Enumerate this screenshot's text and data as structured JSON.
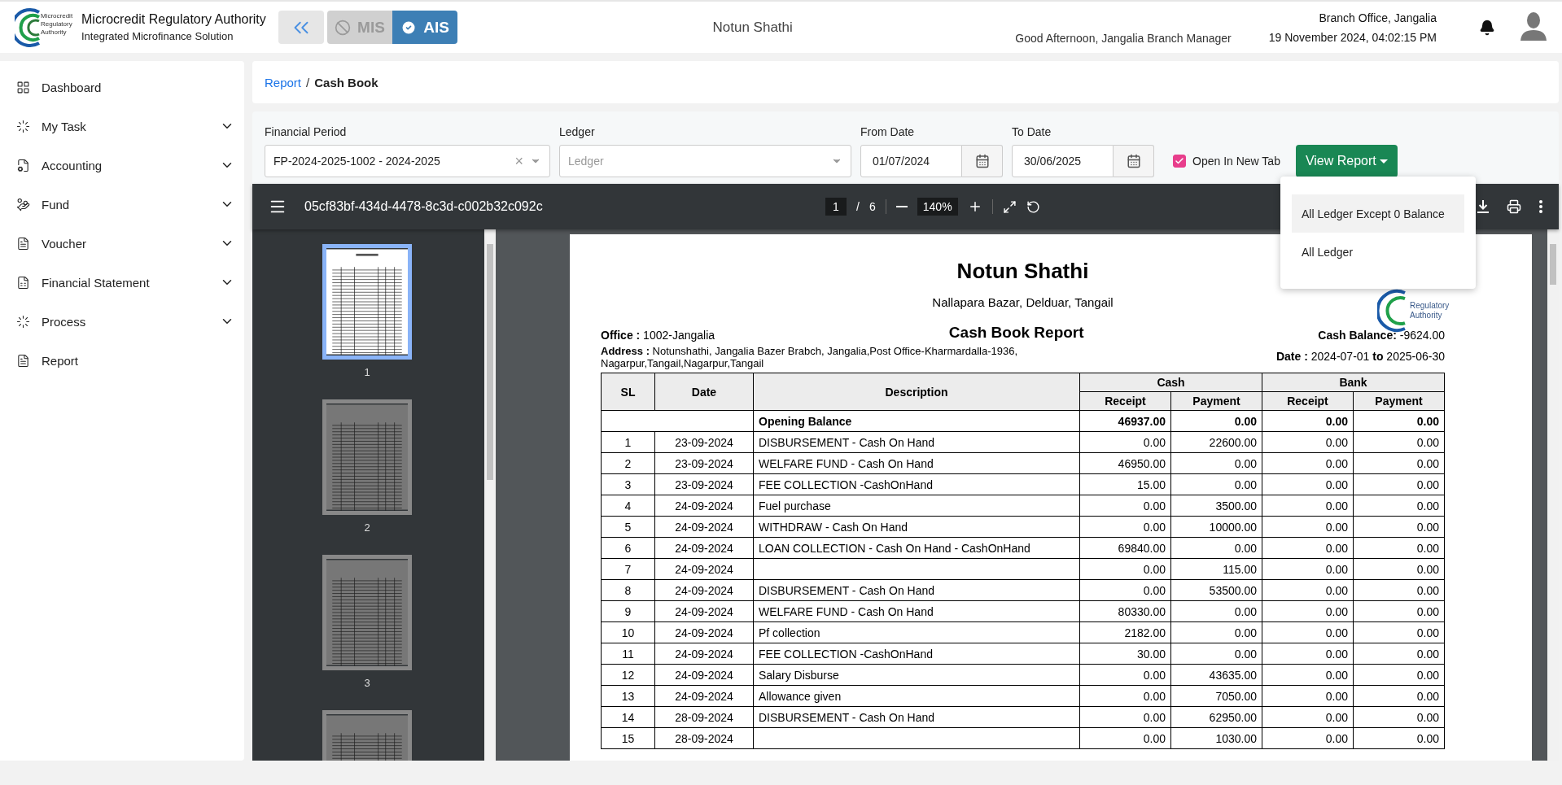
{
  "header": {
    "logo_lines": [
      "Microcredit",
      "Regulatory",
      "Authority"
    ],
    "org_name": "Microcredit Regulatory Authority",
    "org_subtitle": "Integrated Microfinance Solution",
    "modules": [
      {
        "label": "MIS",
        "selected": false
      },
      {
        "label": "AIS",
        "selected": true
      }
    ],
    "center_title": "Notun Shathi",
    "greeting": "Good Afternoon, Jangalia Branch Manager",
    "office": "Branch Office, Jangalia",
    "datetime": "19 November 2024, 04:02:15 PM"
  },
  "sidebar": {
    "items": [
      {
        "label": "Dashboard",
        "expandable": false
      },
      {
        "label": "My Task",
        "expandable": true
      },
      {
        "label": "Accounting",
        "expandable": true
      },
      {
        "label": "Fund",
        "expandable": true
      },
      {
        "label": "Voucher",
        "expandable": true
      },
      {
        "label": "Financial Statement",
        "expandable": true
      },
      {
        "label": "Process",
        "expandable": true
      },
      {
        "label": "Report",
        "expandable": false
      }
    ]
  },
  "breadcrumb": [
    {
      "label": "Report",
      "kind": "link"
    },
    {
      "label": "/",
      "kind": "separator"
    },
    {
      "label": "Cash Book",
      "kind": "current"
    }
  ],
  "filters": {
    "financial_period": {
      "label": "Financial Period",
      "value": "FP-2024-2025-1002 - 2024-2025",
      "clear": "×"
    },
    "ledger": {
      "label": "Ledger",
      "placeholder": "Ledger"
    },
    "from_date": {
      "label": "From Date",
      "value": "01/07/2024"
    },
    "to_date": {
      "label": "To Date",
      "value": "30/06/2025"
    },
    "open_in_new_tab": {
      "label": "Open In New Tab",
      "checked": true
    },
    "view_report": "View Report"
  },
  "report_menu": {
    "items": [
      {
        "label": "All Ledger Except 0 Balance",
        "selected": true
      },
      {
        "label": "All Ledger",
        "selected": false
      }
    ]
  },
  "pdf_viewer": {
    "file_name": "05cf83bf-434d-4478-8c3d-c002b32c092c",
    "page": "1",
    "page_separator": "/",
    "page_count": "6",
    "zoom": "140%",
    "thumbnails": [
      {
        "label": "1",
        "selected": true
      },
      {
        "label": "2",
        "selected": false
      },
      {
        "label": "3",
        "selected": false
      },
      {
        "selected": false
      }
    ]
  },
  "report": {
    "company": "Notun Shathi",
    "company_address": "Nallapara Bazar, Delduar, Tangail",
    "logo_lines": [
      "Regulatory",
      "Authority"
    ],
    "office": "**Office :** 1002-Jangalia",
    "title": "Cash Book Report",
    "cash_balance": "**Cash Balance:** -9624.00",
    "address": "**Address :** Notunshathi, Jangalia Bazer Brabch, Jangalia,Post Office-Kharmardalla-1936, Nagarpur,Tangail,Nagarpur,Tangail",
    "date_range": "**Date :** 2024-07-01 **to** 2025-06-30",
    "table": {
      "columns": {
        "sl": "SL",
        "date": "Date",
        "description": "Description",
        "cash": "Cash",
        "bank": "Bank",
        "cash_receipt": "Receipt",
        "cash_payment": "Payment",
        "bank_receipt": "Receipt",
        "bank_payment": "Payment"
      },
      "opening_balance": {
        "label": "Opening Balance",
        "cash_receipt": "46937.00",
        "cash_payment": "0.00",
        "bank_receipt": "0.00",
        "bank_payment": "0.00"
      },
      "rows": [
        {
          "sl": "1",
          "date": "23-09-2024",
          "description": "DISBURSEMENT - Cash On Hand",
          "cash_receipt": "0.00",
          "cash_payment": "22600.00",
          "bank_receipt": "0.00",
          "bank_payment": "0.00"
        },
        {
          "sl": "2",
          "date": "23-09-2024",
          "description": "WELFARE FUND - Cash On Hand",
          "cash_receipt": "46950.00",
          "cash_payment": "0.00",
          "bank_receipt": "0.00",
          "bank_payment": "0.00"
        },
        {
          "sl": "3",
          "date": "23-09-2024",
          "description": "FEE COLLECTION -CashOnHand",
          "cash_receipt": "15.00",
          "cash_payment": "0.00",
          "bank_receipt": "0.00",
          "bank_payment": "0.00"
        },
        {
          "sl": "4",
          "date": "24-09-2024",
          "description": "Fuel purchase",
          "cash_receipt": "0.00",
          "cash_payment": "3500.00",
          "bank_receipt": "0.00",
          "bank_payment": "0.00"
        },
        {
          "sl": "5",
          "date": "24-09-2024",
          "description": "WITHDRAW - Cash On Hand",
          "cash_receipt": "0.00",
          "cash_payment": "10000.00",
          "bank_receipt": "0.00",
          "bank_payment": "0.00"
        },
        {
          "sl": "6",
          "date": "24-09-2024",
          "description": "LOAN COLLECTION - Cash On Hand - CashOnHand",
          "cash_receipt": "69840.00",
          "cash_payment": "0.00",
          "bank_receipt": "0.00",
          "bank_payment": "0.00"
        },
        {
          "sl": "7",
          "date": "24-09-2024",
          "cash_receipt": "0.00",
          "cash_payment": "115.00",
          "bank_receipt": "0.00",
          "bank_payment": "0.00"
        },
        {
          "sl": "8",
          "date": "24-09-2024",
          "description": "DISBURSEMENT - Cash On Hand",
          "cash_receipt": "0.00",
          "cash_payment": "53500.00",
          "bank_receipt": "0.00",
          "bank_payment": "0.00"
        },
        {
          "sl": "9",
          "date": "24-09-2024",
          "description": "WELFARE FUND - Cash On Hand",
          "cash_receipt": "80330.00",
          "cash_payment": "0.00",
          "bank_receipt": "0.00",
          "bank_payment": "0.00"
        },
        {
          "sl": "10",
          "date": "24-09-2024",
          "description": "Pf collection",
          "cash_receipt": "2182.00",
          "cash_payment": "0.00",
          "bank_receipt": "0.00",
          "bank_payment": "0.00"
        },
        {
          "sl": "11",
          "date": "24-09-2024",
          "description": "FEE COLLECTION -CashOnHand",
          "cash_receipt": "30.00",
          "cash_payment": "0.00",
          "bank_receipt": "0.00",
          "bank_payment": "0.00"
        },
        {
          "sl": "12",
          "date": "24-09-2024",
          "description": "Salary Disburse",
          "cash_receipt": "0.00",
          "cash_payment": "43635.00",
          "bank_receipt": "0.00",
          "bank_payment": "0.00"
        },
        {
          "sl": "13",
          "date": "24-09-2024",
          "description": "Allowance given",
          "cash_receipt": "0.00",
          "cash_payment": "7050.00",
          "bank_receipt": "0.00",
          "bank_payment": "0.00"
        },
        {
          "sl": "14",
          "date": "28-09-2024",
          "description": "DISBURSEMENT - Cash On Hand",
          "cash_receipt": "0.00",
          "cash_payment": "62950.00",
          "bank_receipt": "0.00",
          "bank_payment": "0.00"
        },
        {
          "sl": "15",
          "date": "28-09-2024",
          "cash_receipt": "0.00",
          "cash_payment": "1030.00",
          "bank_receipt": "0.00",
          "bank_payment": "0.00"
        }
      ]
    }
  }
}
